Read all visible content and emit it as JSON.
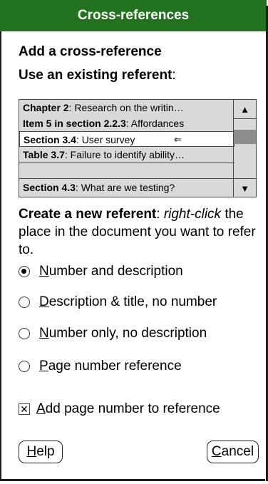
{
  "dialog": {
    "title": "Cross-references"
  },
  "heading1": "Add a cross-reference",
  "heading2": {
    "bold": "Use an existing referent",
    "rest": ":"
  },
  "list": {
    "items": [
      {
        "bold": "Chapter 2",
        "rest": ": Research on the writin…"
      },
      {
        "bold": "Item 5 in section 2.2.3",
        "rest": ": Affordances"
      },
      {
        "bold": "Section 3.4",
        "rest": ": User survey",
        "selected": true,
        "marker": "⇐"
      },
      {
        "bold": "Table 3.7",
        "rest": ": Failure to identify ability…"
      },
      {
        "bold": "Section 4.3",
        "rest": ": What are we testing?"
      }
    ],
    "scroll_up": "▲",
    "scroll_down": "▼"
  },
  "hint": {
    "bold": "Create a new referent",
    "sep": ": ",
    "italic": "right-click",
    "rest": " the place in the document you want to refer to."
  },
  "options": [
    {
      "key": "N",
      "rest": "umber and description",
      "checked": true
    },
    {
      "key": "D",
      "rest": "escription & title, no number",
      "checked": false
    },
    {
      "key": "N",
      "rest": "umber only, no description",
      "checked": false
    },
    {
      "key": "P",
      "rest": "age number reference",
      "checked": false
    }
  ],
  "checkbox": {
    "mark": "✕",
    "key": "A",
    "rest": "dd page number to reference",
    "checked": true
  },
  "buttons": {
    "help": {
      "key": "H",
      "rest": "elp"
    },
    "cancel": {
      "key": "C",
      "rest": "ancel"
    }
  },
  "colors": {
    "title_bar": "#23721f",
    "list_bg": "#d9d9d9"
  }
}
